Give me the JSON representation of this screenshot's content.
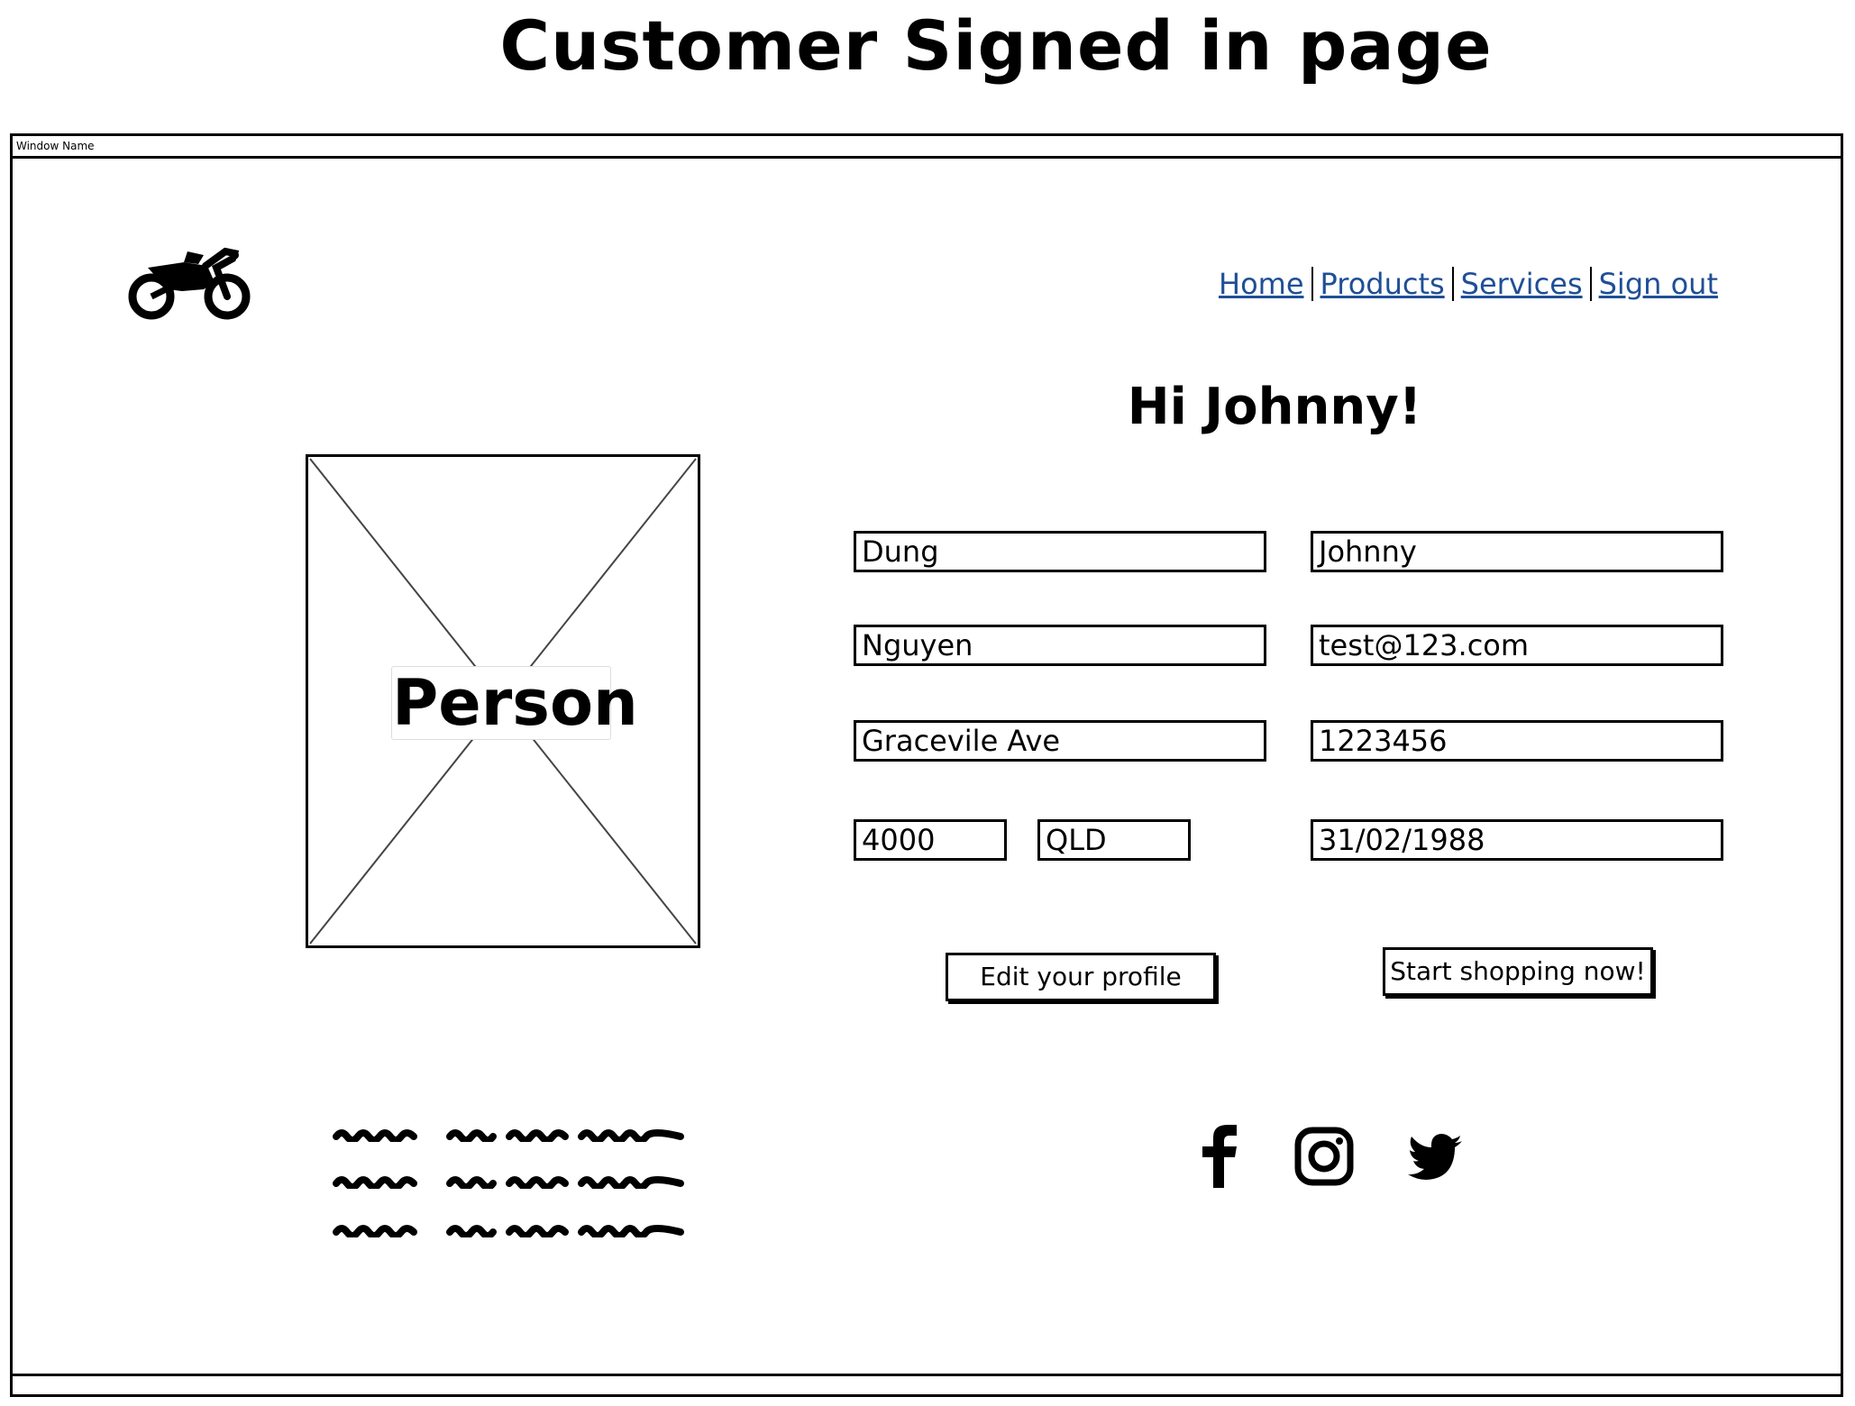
{
  "page_heading": "Customer Signed in page",
  "window": {
    "title": "Window Name"
  },
  "nav": {
    "items": [
      "Home",
      "Products",
      "Services",
      "Sign out"
    ],
    "link_color": "#1f4f96"
  },
  "greeting": "Hi Johnny!",
  "profile_image": {
    "label": "Person"
  },
  "form": {
    "surname": "Dung",
    "first_name": "Johnny",
    "last_name": "Nguyen",
    "email": "test@123.com",
    "street": "Gracevile Ave",
    "phone": "1223456",
    "postcode": "4000",
    "state": "QLD",
    "dob": "31/02/1988"
  },
  "buttons": {
    "edit_profile": "Edit your profile",
    "start_shopping": "Start shopping now!"
  },
  "icons": {
    "logo": "motorcycle-icon",
    "social": [
      "facebook-icon",
      "instagram-icon",
      "twitter-icon"
    ]
  }
}
